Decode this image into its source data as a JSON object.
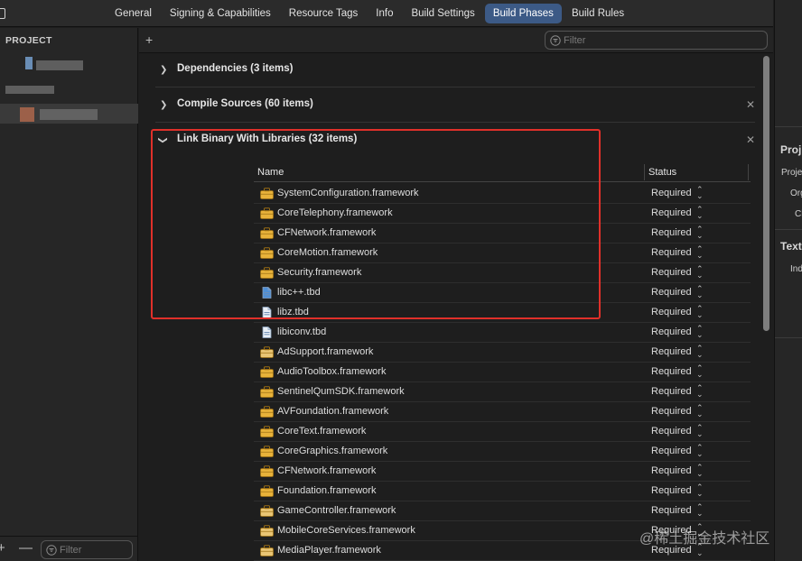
{
  "tabs": [
    "General",
    "Signing & Capabilities",
    "Resource Tags",
    "Info",
    "Build Settings",
    "Build Phases",
    "Build Rules"
  ],
  "active_tab": "Build Phases",
  "sidebar": {
    "header": "PROJECT",
    "filter_placeholder": "Filter",
    "add": "+",
    "remove": "—"
  },
  "main": {
    "add": "+",
    "filter_placeholder": "Filter"
  },
  "phases": {
    "dependencies": "Dependencies (3 items)",
    "compile": "Compile Sources (60 items)",
    "link": "Link Binary With Libraries (32 items)"
  },
  "table": {
    "col_name": "Name",
    "col_status": "Status",
    "rows": [
      {
        "name": "SystemConfiguration.framework",
        "type": "framework",
        "status": "Required"
      },
      {
        "name": "CoreTelephony.framework",
        "type": "framework",
        "status": "Required"
      },
      {
        "name": "CFNetwork.framework",
        "type": "framework",
        "status": "Required"
      },
      {
        "name": "CoreMotion.framework",
        "type": "framework",
        "status": "Required"
      },
      {
        "name": "Security.framework",
        "type": "framework",
        "status": "Required"
      },
      {
        "name": "libc++.tbd",
        "type": "tbd-blue",
        "status": "Required"
      },
      {
        "name": "libz.tbd",
        "type": "tbd",
        "status": "Required"
      },
      {
        "name": "libiconv.tbd",
        "type": "tbd",
        "status": "Required"
      },
      {
        "name": "AdSupport.framework",
        "type": "framework-light",
        "status": "Required"
      },
      {
        "name": "AudioToolbox.framework",
        "type": "framework",
        "status": "Required"
      },
      {
        "name": "SentinelQumSDK.framework",
        "type": "framework",
        "status": "Required"
      },
      {
        "name": "AVFoundation.framework",
        "type": "framework",
        "status": "Required"
      },
      {
        "name": "CoreText.framework",
        "type": "framework",
        "status": "Required"
      },
      {
        "name": "CoreGraphics.framework",
        "type": "framework",
        "status": "Required"
      },
      {
        "name": "CFNetwork.framework",
        "type": "framework",
        "status": "Required"
      },
      {
        "name": "Foundation.framework",
        "type": "framework",
        "status": "Required"
      },
      {
        "name": "GameController.framework",
        "type": "framework-light",
        "status": "Required"
      },
      {
        "name": "MobileCoreServices.framework",
        "type": "framework-light",
        "status": "Required"
      },
      {
        "name": "MediaPlayer.framework",
        "type": "framework-light",
        "status": "Required"
      }
    ]
  },
  "inspector": {
    "section1": "Proj",
    "item1": "Proje",
    "item2": "Org",
    "item3": "Cl",
    "section2": "Text",
    "item4": "Ind"
  },
  "watermark": "@稀土掘金技术社区",
  "colors": {
    "accent_tab": "#3c5a86",
    "highlight_box": "#e0302a",
    "framework_icon": "#e8b23a"
  },
  "icons": {
    "framework": "toolbox-icon",
    "tbd": "document-icon",
    "filter": "filter-icon"
  }
}
